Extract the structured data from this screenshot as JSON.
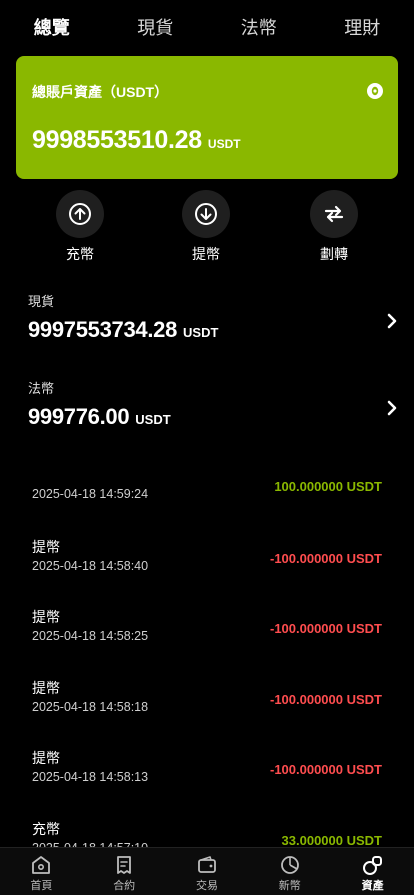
{
  "tabs": [
    "總覽",
    "現貨",
    "法幣",
    "理財"
  ],
  "summary": {
    "title": "總賬戶資產（USDT）",
    "amount": "9998553510.28",
    "unit": "USDT"
  },
  "actions": [
    {
      "label": "充幣",
      "icon": "arrow-up-icon"
    },
    {
      "label": "提幣",
      "icon": "arrow-down-icon"
    },
    {
      "label": "劃轉",
      "icon": "transfer-icon"
    }
  ],
  "accounts": [
    {
      "name": "現貨",
      "amount": "9997553734.28",
      "unit": "USDT"
    },
    {
      "name": "法幣",
      "amount": "999776.00",
      "unit": "USDT"
    }
  ],
  "transactions": [
    {
      "type": "",
      "time": "2025-04-18 14:59:24",
      "value": "100.000000 USDT",
      "direction": "in"
    },
    {
      "type": "提幣",
      "time": "2025-04-18 14:58:40",
      "value": "-100.000000 USDT",
      "direction": "out"
    },
    {
      "type": "提幣",
      "time": "2025-04-18 14:58:25",
      "value": "-100.000000 USDT",
      "direction": "out"
    },
    {
      "type": "提幣",
      "time": "2025-04-18 14:58:18",
      "value": "-100.000000 USDT",
      "direction": "out"
    },
    {
      "type": "提幣",
      "time": "2025-04-18 14:58:13",
      "value": "-100.000000 USDT",
      "direction": "out"
    },
    {
      "type": "充幣",
      "time": "2025-04-18 14:57:10",
      "value": "33.000000 USDT",
      "direction": "in"
    }
  ],
  "bottom_nav": [
    {
      "label": "首頁",
      "icon": "home-icon"
    },
    {
      "label": "合約",
      "icon": "contract-icon"
    },
    {
      "label": "交易",
      "icon": "wallet-icon"
    },
    {
      "label": "新幣",
      "icon": "pie-chart-icon"
    },
    {
      "label": "資產",
      "icon": "assets-icon",
      "active": true
    }
  ],
  "colors": {
    "accent_card": "#8ab800",
    "positive": "#8ab800",
    "negative": "#ff4d4f"
  }
}
